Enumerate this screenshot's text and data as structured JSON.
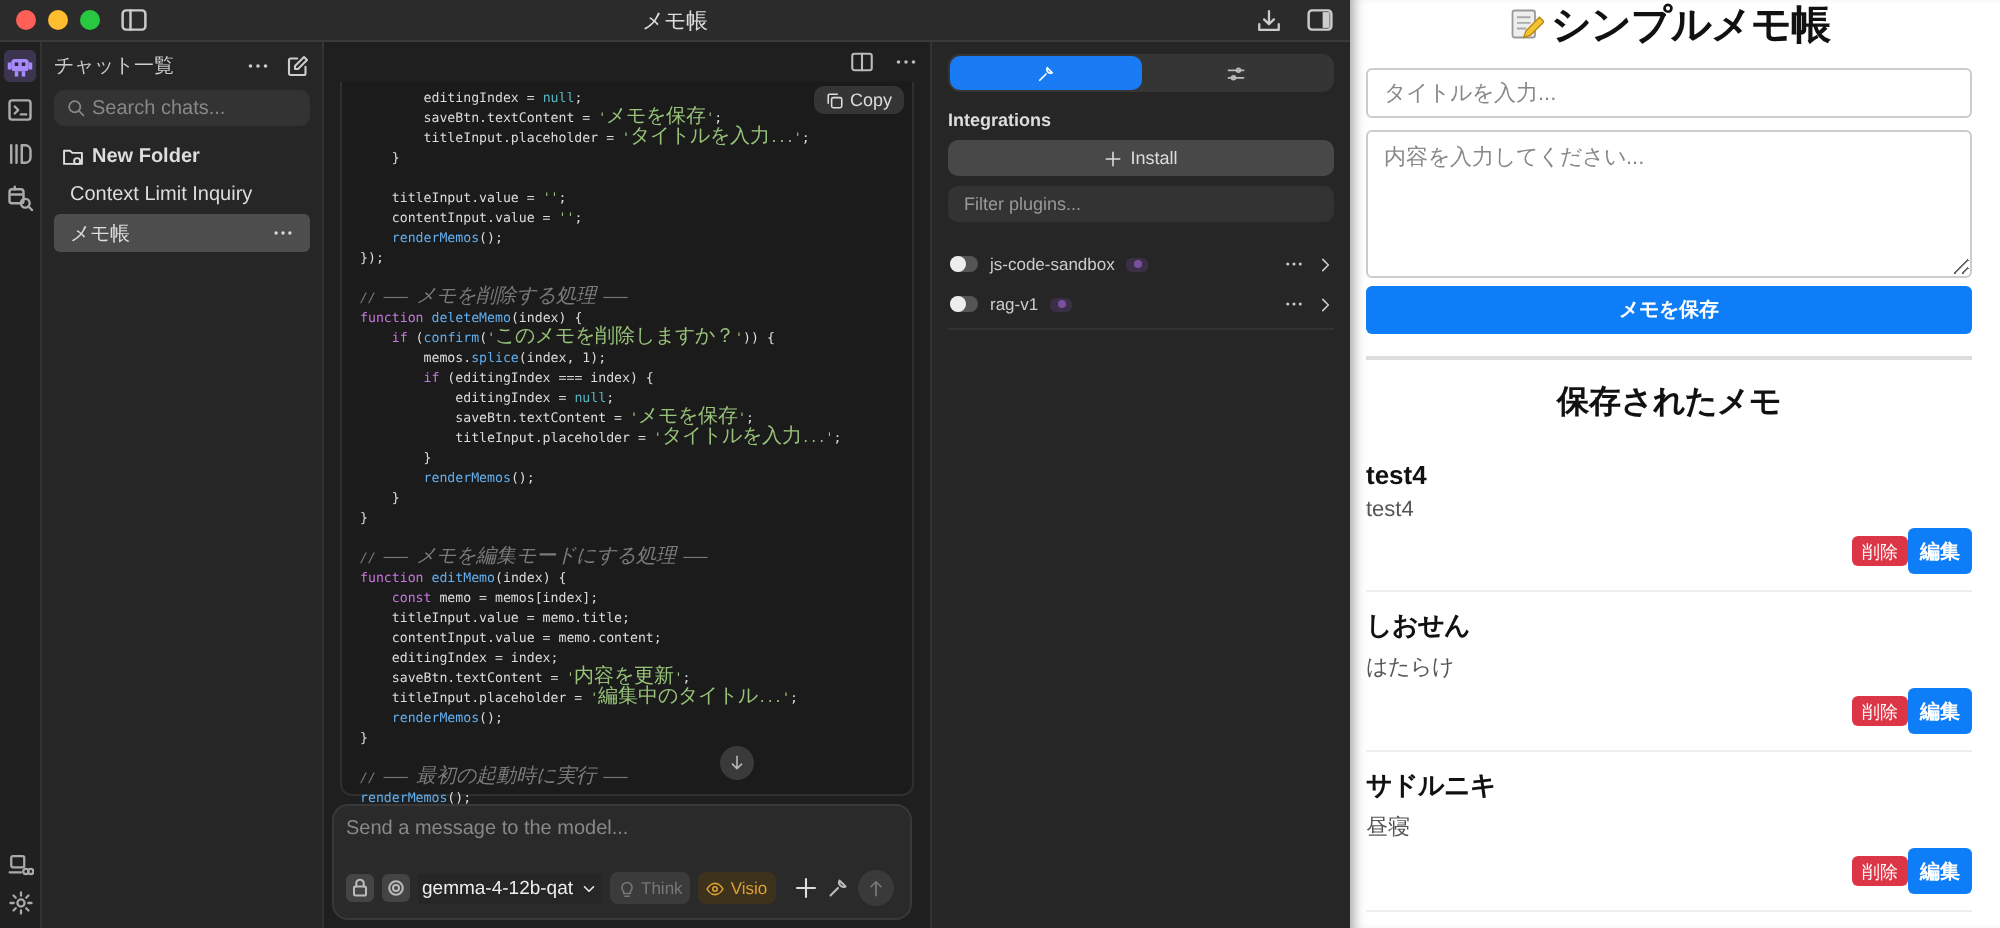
{
  "window": {
    "title": "メモ帳"
  },
  "rail": {
    "items": [
      {
        "kind": "chat",
        "selected": true
      },
      {
        "kind": "terminal",
        "selected": false
      },
      {
        "kind": "models",
        "selected": false
      },
      {
        "kind": "discover",
        "selected": false
      }
    ]
  },
  "sidebar": {
    "title": "チャット一覧",
    "search": {
      "placeholder": "Search chats..."
    },
    "items": [
      {
        "kind": "folder",
        "label": "New Folder",
        "selected": false
      },
      {
        "kind": "chat",
        "label": "Context Limit Inquiry",
        "selected": false
      },
      {
        "kind": "chat",
        "label": "メモ帳",
        "selected": true
      }
    ]
  },
  "code_block": {
    "copy_label": "Copy",
    "blocks": [
      {
        "lines": [
          {
            "tokens": [
              {
                "kind": "plain",
                "text": "        editingIndex = "
              },
              {
                "kind": "literal",
                "text": "null"
              },
              {
                "kind": "plain",
                "text": ";"
              }
            ]
          },
          {
            "tokens": [
              {
                "kind": "plain",
                "text": "        saveBtn.textContent = "
              },
              {
                "kind": "string",
                "text": "'メモを保存'"
              },
              {
                "kind": "plain",
                "text": ";"
              }
            ]
          },
          {
            "tokens": [
              {
                "kind": "plain",
                "text": "        titleInput.placeholder = "
              },
              {
                "kind": "string",
                "text": "'タイトルを入力...'"
              },
              {
                "kind": "plain",
                "text": ";"
              }
            ]
          },
          {
            "tokens": [
              {
                "kind": "plain",
                "text": "    }"
              }
            ]
          }
        ]
      },
      {
        "lines": [
          {
            "tokens": [
              {
                "kind": "plain",
                "text": "    titleInput.value = "
              },
              {
                "kind": "string",
                "text": "''"
              },
              {
                "kind": "plain",
                "text": ";"
              }
            ]
          },
          {
            "tokens": [
              {
                "kind": "plain",
                "text": "    contentInput.value = "
              },
              {
                "kind": "string",
                "text": "''"
              },
              {
                "kind": "plain",
                "text": ";"
              }
            ]
          },
          {
            "tokens": [
              {
                "kind": "function",
                "text": "    renderMemos"
              },
              {
                "kind": "plain",
                "text": "();"
              }
            ]
          },
          {
            "tokens": [
              {
                "kind": "plain",
                "text": "});"
              }
            ]
          }
        ]
      },
      {
        "lines": [
          {
            "tokens": [
              {
                "kind": "comment",
                "text": "// ─── メモを削除する処理 ───"
              }
            ]
          },
          {
            "tokens": [
              {
                "kind": "keyword",
                "text": "function "
              },
              {
                "kind": "function",
                "text": "deleteMemo"
              },
              {
                "kind": "plain",
                "text": "(index) {"
              }
            ]
          },
          {
            "tokens": [
              {
                "kind": "keyword",
                "text": "    if"
              },
              {
                "kind": "plain",
                "text": " ("
              },
              {
                "kind": "function",
                "text": "confirm"
              },
              {
                "kind": "plain",
                "text": "("
              },
              {
                "kind": "string",
                "text": "'このメモを削除しますか？'"
              },
              {
                "kind": "plain",
                "text": ")) {"
              }
            ]
          },
          {
            "tokens": [
              {
                "kind": "plain",
                "text": "        memos."
              },
              {
                "kind": "function",
                "text": "splice"
              },
              {
                "kind": "plain",
                "text": "(index, 1);"
              }
            ]
          },
          {
            "tokens": [
              {
                "kind": "keyword",
                "text": "        if"
              },
              {
                "kind": "plain",
                "text": " (editingIndex === index) {"
              }
            ]
          },
          {
            "tokens": [
              {
                "kind": "plain",
                "text": "            editingIndex = "
              },
              {
                "kind": "literal",
                "text": "null"
              },
              {
                "kind": "plain",
                "text": ";"
              }
            ]
          },
          {
            "tokens": [
              {
                "kind": "plain",
                "text": "            saveBtn.textContent = "
              },
              {
                "kind": "string",
                "text": "'メモを保存'"
              },
              {
                "kind": "plain",
                "text": ";"
              }
            ]
          },
          {
            "tokens": [
              {
                "kind": "plain",
                "text": "            titleInput.placeholder = "
              },
              {
                "kind": "string",
                "text": "'タイトルを入力...'"
              },
              {
                "kind": "plain",
                "text": ";"
              }
            ]
          },
          {
            "tokens": [
              {
                "kind": "plain",
                "text": "        }"
              }
            ]
          },
          {
            "tokens": [
              {
                "kind": "function",
                "text": "        renderMemos"
              },
              {
                "kind": "plain",
                "text": "();"
              }
            ]
          },
          {
            "tokens": [
              {
                "kind": "plain",
                "text": "    }"
              }
            ]
          },
          {
            "tokens": [
              {
                "kind": "plain",
                "text": "}"
              }
            ]
          }
        ]
      },
      {
        "lines": [
          {
            "tokens": [
              {
                "kind": "comment",
                "text": "// ─── メモを編集モードにする処理 ───"
              }
            ]
          },
          {
            "tokens": [
              {
                "kind": "keyword",
                "text": "function "
              },
              {
                "kind": "function",
                "text": "editMemo"
              },
              {
                "kind": "plain",
                "text": "(index) {"
              }
            ]
          },
          {
            "tokens": [
              {
                "kind": "keyword",
                "text": "    const"
              },
              {
                "kind": "plain",
                "text": " memo = memos[index];"
              }
            ]
          },
          {
            "tokens": [
              {
                "kind": "plain",
                "text": "    titleInput.value = memo.title;"
              }
            ]
          },
          {
            "tokens": [
              {
                "kind": "plain",
                "text": "    contentInput.value = memo.content;"
              }
            ]
          },
          {
            "tokens": [
              {
                "kind": "plain",
                "text": "    editingIndex = index;"
              }
            ]
          },
          {
            "tokens": [
              {
                "kind": "plain",
                "text": "    saveBtn.textContent = "
              },
              {
                "kind": "string",
                "text": "'内容を更新'"
              },
              {
                "kind": "plain",
                "text": ";"
              }
            ]
          },
          {
            "tokens": [
              {
                "kind": "plain",
                "text": "    titleInput.placeholder = "
              },
              {
                "kind": "string",
                "text": "'編集中のタイトル...'"
              },
              {
                "kind": "plain",
                "text": ";"
              }
            ]
          },
          {
            "tokens": [
              {
                "kind": "function",
                "text": "    renderMemos"
              },
              {
                "kind": "plain",
                "text": "();"
              }
            ]
          },
          {
            "tokens": [
              {
                "kind": "plain",
                "text": "}"
              }
            ]
          }
        ]
      },
      {
        "lines": [
          {
            "tokens": [
              {
                "kind": "comment",
                "text": "// ─── 最初の起動時に実行 ───"
              }
            ]
          },
          {
            "tokens": [
              {
                "kind": "function",
                "text": "renderMemos"
              },
              {
                "kind": "plain",
                "text": "();"
              }
            ]
          }
        ]
      }
    ]
  },
  "composer": {
    "placeholder": "Send a message to the model...",
    "model": "gemma-4-12b-qat",
    "think": {
      "label": "Think",
      "on": false
    },
    "vision": {
      "label": "Visio",
      "on": true
    }
  },
  "plugins_panel": {
    "tabs": [
      {
        "kind": "tools",
        "selected": true
      },
      {
        "kind": "settings",
        "selected": false
      }
    ],
    "heading": "Integrations",
    "install_label": "Install",
    "filter": {
      "placeholder": "Filter plugins..."
    },
    "plugins": [
      {
        "name": "js-code-sandbox",
        "enabled": false
      },
      {
        "name": "rag-v1",
        "enabled": false
      }
    ]
  },
  "memo_app": {
    "title": "シンプルメモ帳",
    "title_placeholder": "タイトルを入力...",
    "content_placeholder": "内容を入力してください...",
    "save_label": "メモを保存",
    "list_heading": "保存されたメモ",
    "memos": [
      {
        "title": "test4",
        "content": "test4",
        "delete_label": "削除",
        "edit_label": "編集"
      },
      {
        "title": "しおせん",
        "content": "はたらけ",
        "delete_label": "削除",
        "edit_label": "編集"
      },
      {
        "title": "サドルニキ",
        "content": "昼寝",
        "delete_label": "削除",
        "edit_label": "編集"
      }
    ]
  }
}
